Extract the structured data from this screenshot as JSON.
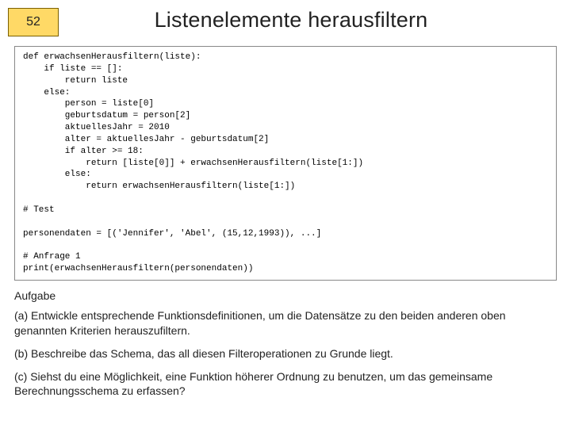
{
  "page_number": "52",
  "title": "Listenelemente herausfiltern",
  "code": "def erwachsenHerausfiltern(liste):\n    if liste == []:\n        return liste\n    else:\n        person = liste[0]\n        geburtsdatum = person[2]\n        aktuellesJahr = 2010\n        alter = aktuellesJahr - geburtsdatum[2]\n        if alter >= 18:\n            return [liste[0]] + erwachsenHerausfiltern(liste[1:])\n        else:\n            return erwachsenHerausfiltern(liste[1:])\n\n# Test\n\npersonendaten = [('Jennifer', 'Abel', (15,12,1993)), ...]\n\n# Anfrage 1\nprint(erwachsenHerausfiltern(personendaten))",
  "section_label": "Aufgabe",
  "task_a": "(a) Entwickle entsprechende Funktionsdefinitionen, um die Datensätze zu den beiden anderen oben genannten Kriterien herauszufiltern.",
  "task_b": "(b) Beschreibe das Schema, das all diesen Filteroperationen zu Grunde liegt.",
  "task_c": "(c) Siehst du eine Möglichkeit, eine Funktion höherer Ordnung zu benutzen, um das gemeinsame Berechnungsschema zu erfassen?"
}
